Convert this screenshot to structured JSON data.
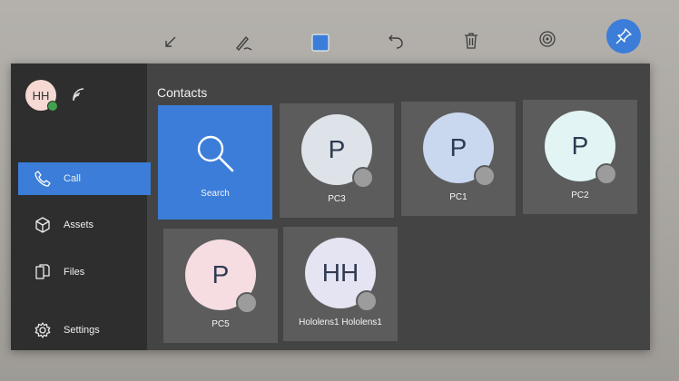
{
  "colors": {
    "accent": "#3b7dd8",
    "sidebar_bg": "#2e2e2e",
    "panel_bg": "#444444",
    "tile_bg": "#5c5c5c",
    "presence_green": "#3fa34d",
    "status_gray": "#9c9c9c"
  },
  "toolbar": {
    "icons": [
      "collapse-arrow-icon",
      "pen-icon",
      "square-shape-icon",
      "undo-icon",
      "trash-icon",
      "target-icon",
      "pin-icon"
    ]
  },
  "user": {
    "initials": "HH",
    "presence": "available"
  },
  "sidebar": {
    "items": [
      {
        "label": "Call",
        "icon": "phone-icon",
        "active": true
      },
      {
        "label": "Assets",
        "icon": "cube-icon",
        "active": false
      },
      {
        "label": "Files",
        "icon": "files-icon",
        "active": false
      },
      {
        "label": "Settings",
        "icon": "gear-icon",
        "active": false
      }
    ]
  },
  "contacts": {
    "title": "Contacts",
    "search_label": "Search",
    "tiles": [
      {
        "initials": "P",
        "name": "PC3",
        "color": "#dde3e8"
      },
      {
        "initials": "P",
        "name": "PC1",
        "color": "#c9d8ef"
      },
      {
        "initials": "P",
        "name": "PC2",
        "color": "#e2f5f4"
      },
      {
        "initials": "P",
        "name": "PC5",
        "color": "#f6dde2"
      },
      {
        "initials": "HH",
        "name": "Hololens1 Hololens1",
        "color": "#e4e4f2"
      }
    ]
  }
}
